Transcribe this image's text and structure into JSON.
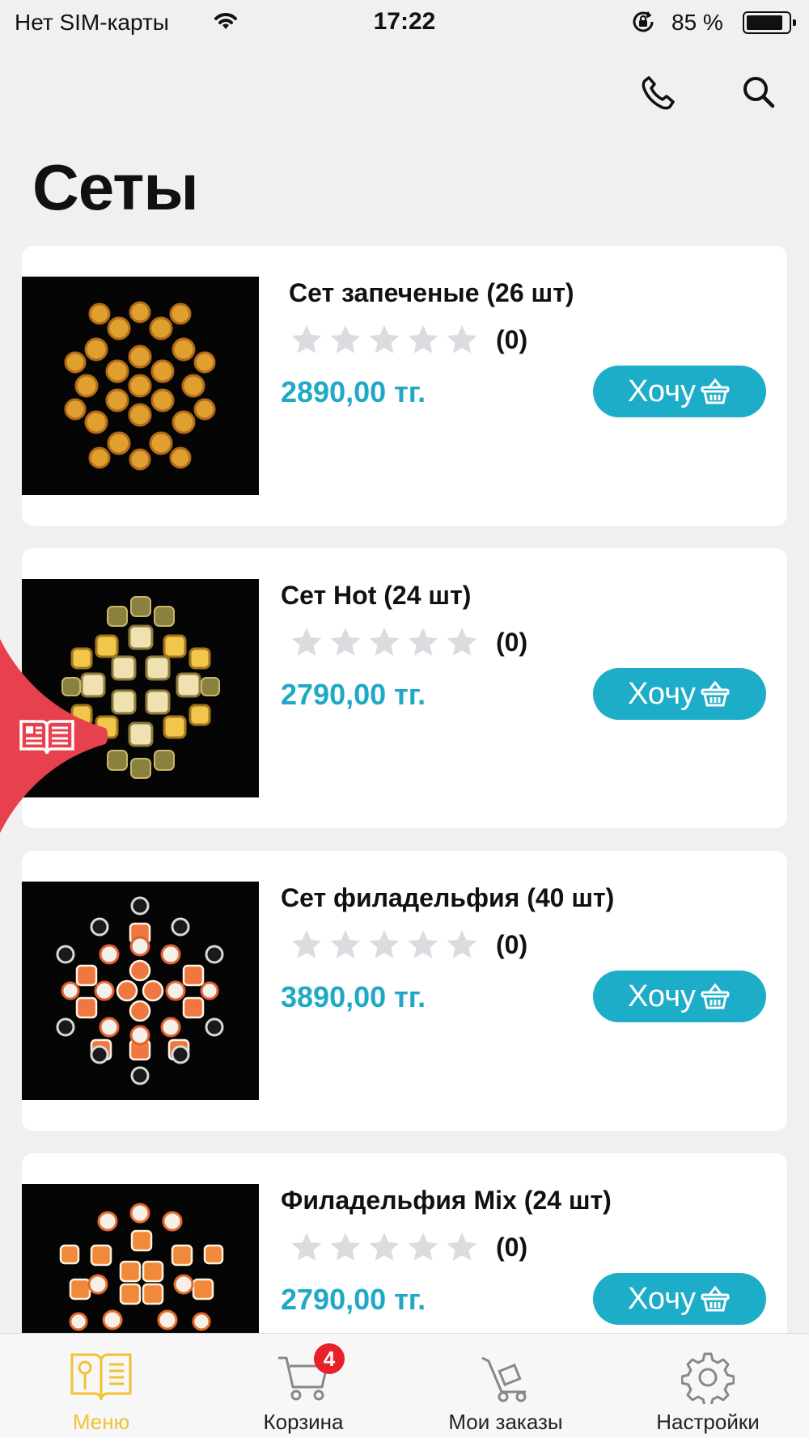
{
  "status_bar": {
    "carrier": "Нет SIM-карты",
    "time": "17:22",
    "battery": "85 %"
  },
  "header": {
    "title": "Сеты",
    "phone_icon": "phone-icon",
    "search_icon": "search-icon"
  },
  "products": [
    {
      "name": "Сет запеченые (26 шт)",
      "rating_count": "(0)",
      "price": "2890,00 тг.",
      "button": "Хочу"
    },
    {
      "name": "Сет Hot (24 шт)",
      "rating_count": "(0)",
      "price": "2790,00 тг.",
      "button": "Хочу"
    },
    {
      "name": "Сет филадельфия (40 шт)",
      "rating_count": "(0)",
      "price": "3890,00 тг.",
      "button": "Хочу"
    },
    {
      "name": "Филадельфия Mix (24 шт)",
      "rating_count": "(0)",
      "price": "2790,00 тг.",
      "button": "Хочу"
    }
  ],
  "tabs": [
    {
      "label": "Меню",
      "icon": "menu-book-icon",
      "active": true
    },
    {
      "label": "Корзина",
      "icon": "cart-icon",
      "badge": "4"
    },
    {
      "label": "Мои заказы",
      "icon": "orders-cart-icon"
    },
    {
      "label": "Настройки",
      "icon": "gear-icon"
    }
  ],
  "colors": {
    "accent": "#1EADC8",
    "price": "#1FA9C6",
    "active_tab": "#F2C230",
    "floating_tab": "#E8414E",
    "badge": "#E8202A"
  }
}
